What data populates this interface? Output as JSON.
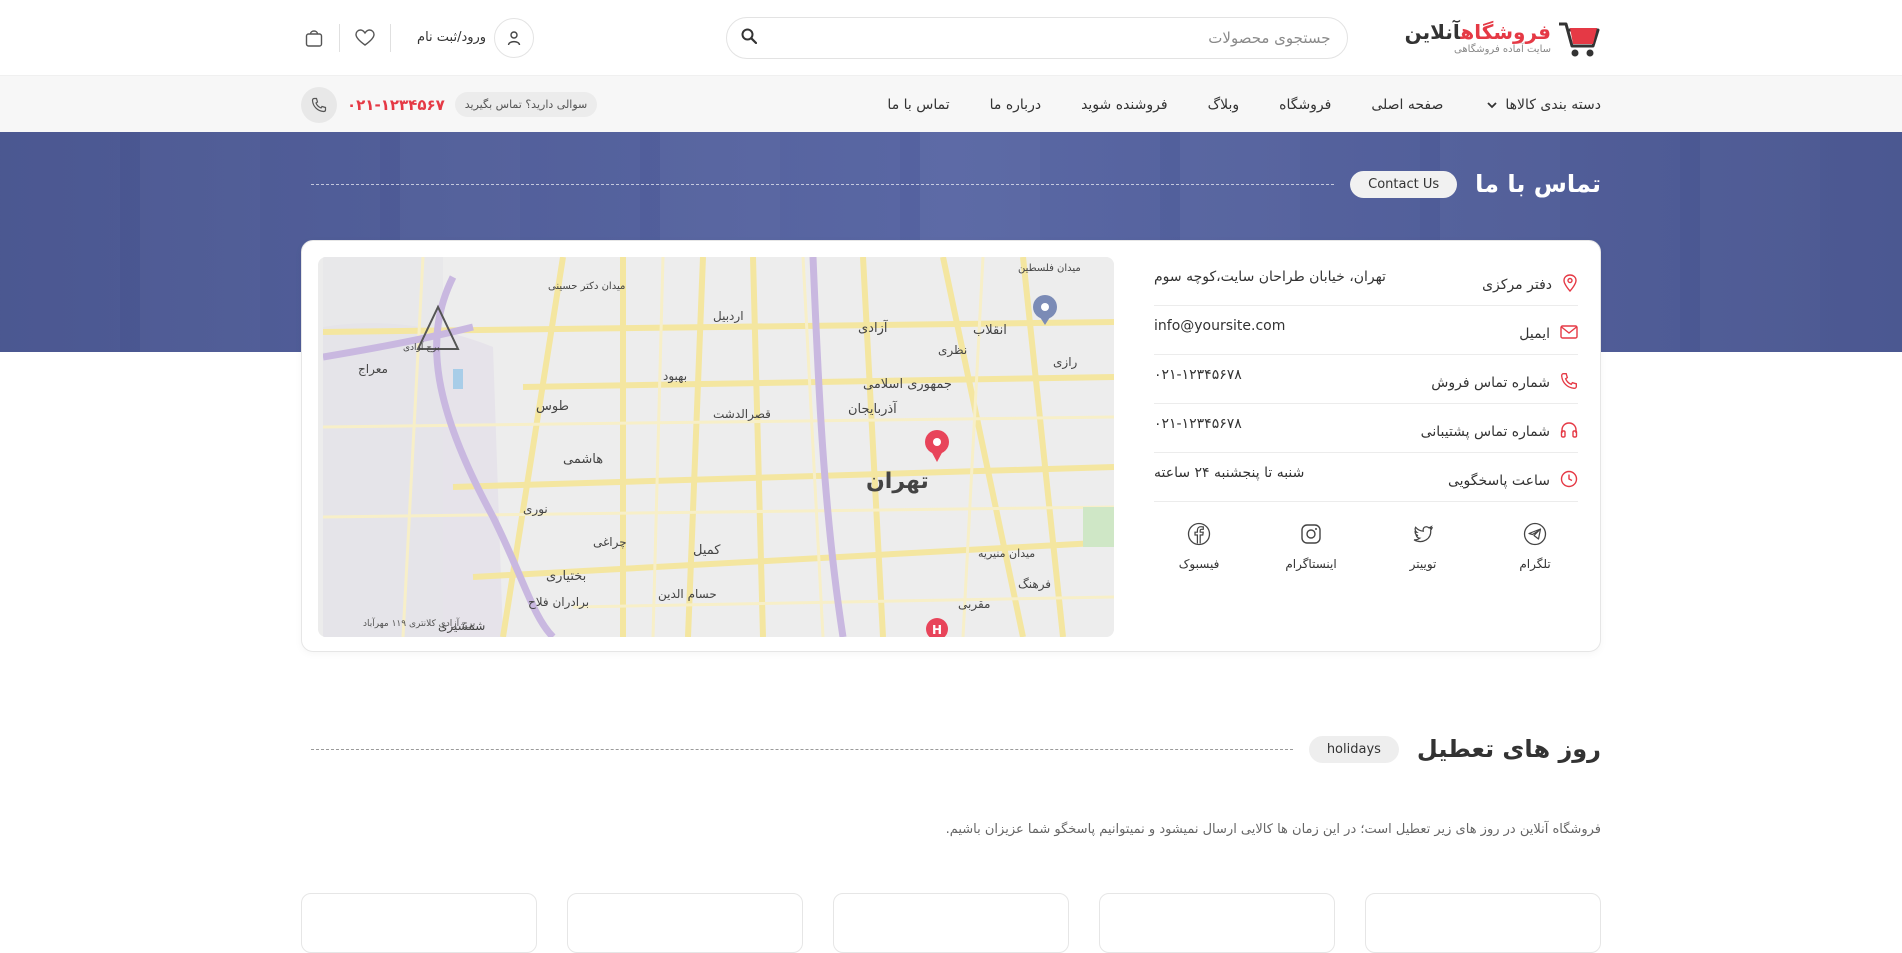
{
  "header": {
    "logo_brand_red": "فروشگاه",
    "logo_brand_dark": "آنلاین",
    "logo_tagline": "سایت آماده فروشگاهی",
    "search_placeholder": "جستجوی محصولات",
    "login_label": "ورود/ثبت نام",
    "icons": [
      "cart-logo-icon",
      "search-icon",
      "user-icon",
      "heart-icon",
      "bag-icon"
    ]
  },
  "nav": {
    "categories": "دسته بندی کالاها",
    "items": [
      "صفحه اصلی",
      "فروشگاه",
      "وبلاگ",
      "فروشنده شوید",
      "درباره ما",
      "تماس با ما"
    ],
    "question": "سوالی دارید؟ تماس بگیرید",
    "phone": "۰۲۱-۱۲۳۴۵۶۷"
  },
  "hero": {
    "title": "تماس با ما",
    "subtitle_en": "Contact Us"
  },
  "contact": {
    "rows": [
      {
        "icon": "location-icon",
        "label": "دفتر مرکزی",
        "value": "تهران، خیابان طراحان سایت،کوچه سوم"
      },
      {
        "icon": "mail-icon",
        "label": "ایمیل",
        "value": "info@yoursite.com"
      },
      {
        "icon": "phone-icon",
        "label": "شماره تماس فروش",
        "value": "۰۲۱-۱۲۳۴۵۶۷۸"
      },
      {
        "icon": "headphones-icon",
        "label": "شماره تماس پشتیبانی",
        "value": "۰۲۱-۱۲۳۴۵۶۷۸"
      },
      {
        "icon": "clock-icon",
        "label": "ساعت پاسخگویی",
        "value": "شنبه تا پنجشنبه ۲۴ ساعته"
      }
    ],
    "socials": [
      {
        "icon": "telegram-icon",
        "label": "تلگرام"
      },
      {
        "icon": "twitter-icon",
        "label": "توییتر"
      },
      {
        "icon": "instagram-icon",
        "label": "اینستاگرام"
      },
      {
        "icon": "facebook-icon",
        "label": "فیسبوک"
      }
    ]
  },
  "map": {
    "city": "تهران",
    "labels": [
      "آزادی",
      "انقلاب",
      "جمهوری اسلامی",
      "آذربایجان",
      "هاشمی",
      "طوس",
      "کمیل",
      "بختیاری",
      "برادران فلاح",
      "حسام الدین",
      "مقربی",
      "فرهنگ",
      "میدان منیریه",
      "نظری",
      "اردبیل",
      "بهبود",
      "قصرالدشت",
      "چراغی",
      "نوری",
      "شمشیری",
      "معراج",
      "رازی",
      "میدان فلسطین",
      "میدان دکتر حسینی",
      "برج آزادی",
      "برج آزادی کلانتری ۱۱۹ مهرآباد"
    ]
  },
  "holidays": {
    "title": "روز های تعطیل",
    "subtitle_en": "holidays",
    "description": "فروشگاه آنلاین در روز های زیر تعطیل است؛ در این زمان ها کالایی ارسال نمیشود و نمیتوانیم پاسخگو شما عزیزان باشیم."
  },
  "colors": {
    "accent": "#e53945",
    "hero_overlay": "#4d5b9a",
    "navbar_bg": "#f7f7f7"
  }
}
